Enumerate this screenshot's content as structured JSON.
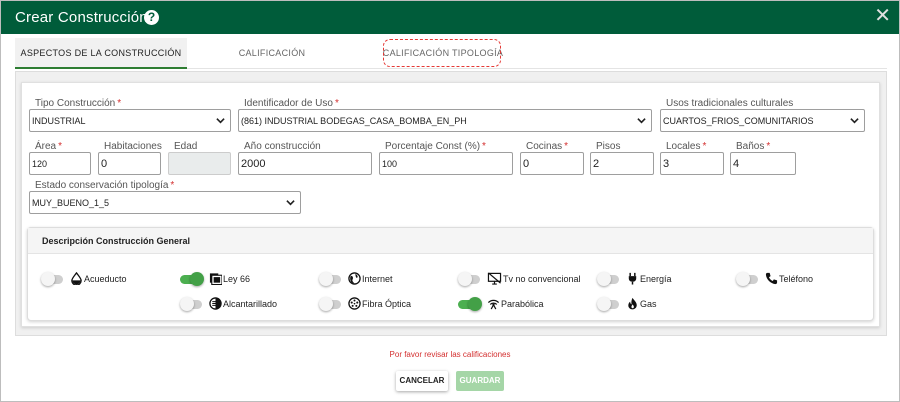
{
  "dialog": {
    "title": "Crear Construcción",
    "help": "?",
    "close": "✕"
  },
  "tabs": [
    {
      "label": "ASPECTOS DE LA CONSTRUCCIÓN"
    },
    {
      "label": "CALIFICACIÓN"
    },
    {
      "label": "CALIFICACIÓN TIPOLOGÍA"
    }
  ],
  "fields": {
    "tipo_construccion": {
      "label": "Tipo Construcción",
      "value": "INDUSTRIAL"
    },
    "identificador_uso": {
      "label": "Identificador de Uso",
      "value": "(861) INDUSTRIAL BODEGAS_CASA_BOMBA_EN_PH"
    },
    "usos_tradicionales": {
      "label": "Usos tradicionales culturales",
      "value": "CUARTOS_FRIOS_COMUNITARIOS"
    },
    "area": {
      "label": "Área",
      "value": "120"
    },
    "habitaciones": {
      "label": "Habitaciones",
      "value": "0"
    },
    "edad": {
      "label": "Edad",
      "value": ""
    },
    "anio_construccion": {
      "label": "Año construcción",
      "value": "2000"
    },
    "porcentaje_const": {
      "label": "Porcentaje Const (%)",
      "value": "100"
    },
    "cocinas": {
      "label": "Cocinas",
      "value": "0"
    },
    "pisos": {
      "label": "Pisos",
      "value": "2"
    },
    "locales": {
      "label": "Locales",
      "value": "3"
    },
    "banos": {
      "label": "Baños",
      "value": "4"
    },
    "estado_conservacion": {
      "label": "Estado conservación tipología",
      "value": "MUY_BUENO_1_5"
    },
    "required_marker": "*"
  },
  "descripcion": {
    "title": "Descripción Construcción General",
    "services": {
      "acueducto": {
        "label": "Acueducto",
        "icon": "water-drop-icon",
        "on": false
      },
      "ley66": {
        "label": "Ley 66",
        "icon": "book-icon",
        "on": true
      },
      "internet": {
        "label": "Internet",
        "icon": "globe-icon",
        "on": false
      },
      "tv": {
        "label": "Tv no convencional",
        "icon": "tv-icon",
        "on": false
      },
      "energia": {
        "label": "Energía",
        "icon": "plug-icon",
        "on": false
      },
      "telefono": {
        "label": "Teléfono",
        "icon": "phone-icon",
        "on": false
      },
      "alcantarillado": {
        "label": "Alcantarillado",
        "icon": "sewer-icon",
        "on": false
      },
      "fibra": {
        "label": "Fibra Óptica",
        "icon": "fiber-icon",
        "on": false
      },
      "parabolica": {
        "label": "Parabólica",
        "icon": "satellite-dish-icon",
        "on": true
      },
      "gas": {
        "label": "Gas",
        "icon": "flame-icon",
        "on": false
      }
    }
  },
  "footer": {
    "message": "Por favor revisar las calificaciones",
    "cancel_label": "CANCELAR",
    "save_label": "GUARDAR"
  },
  "colors": {
    "title_bar": "#005c3a",
    "active_tab_underline": "#2e7d32",
    "required": "#d32f2f",
    "switch_on": "#4caf50",
    "save_disabled": "#a5d6a7"
  }
}
